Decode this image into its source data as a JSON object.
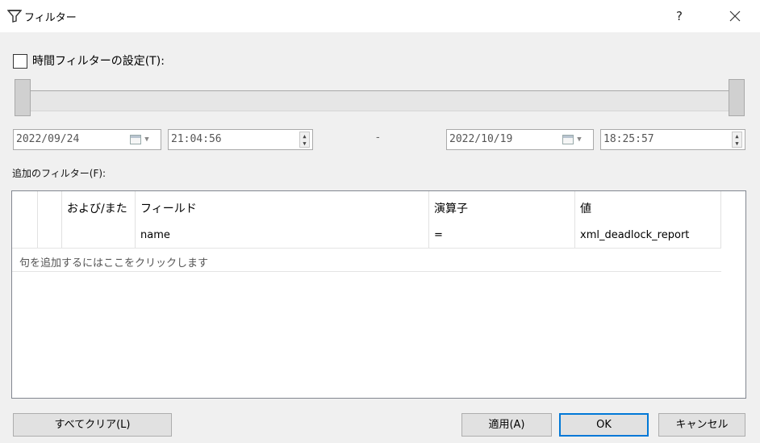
{
  "window": {
    "title": "フィルター",
    "title_icon": "filter-funnel-icon",
    "help_label": "?",
    "close_icon": "close-icon"
  },
  "time_filter": {
    "checkbox_label": "時間フィルターの設定(T):",
    "checked": false,
    "start_date": "2022/09/24",
    "start_time": "21:04:56",
    "separator": "-",
    "end_date": "2022/10/19",
    "end_time": "18:25:57"
  },
  "additional_filters": {
    "label": "追加のフィルター(F):",
    "columns": [
      "",
      "",
      "および/また",
      "フィールド",
      "演算子",
      "値"
    ],
    "rows": [
      {
        "and_or": "",
        "field": "name",
        "operator": "=",
        "value": "xml_deadlock_report"
      }
    ],
    "add_clause_text": "句を追加するにはここをクリックします"
  },
  "buttons": {
    "clear_all": "すべてクリア(L)",
    "apply": "適用(A)",
    "ok": "OK",
    "cancel": "キャンセル"
  },
  "colors": {
    "ok_focus_border": "#0078d7",
    "dialog_background": "#f0f0f0"
  }
}
